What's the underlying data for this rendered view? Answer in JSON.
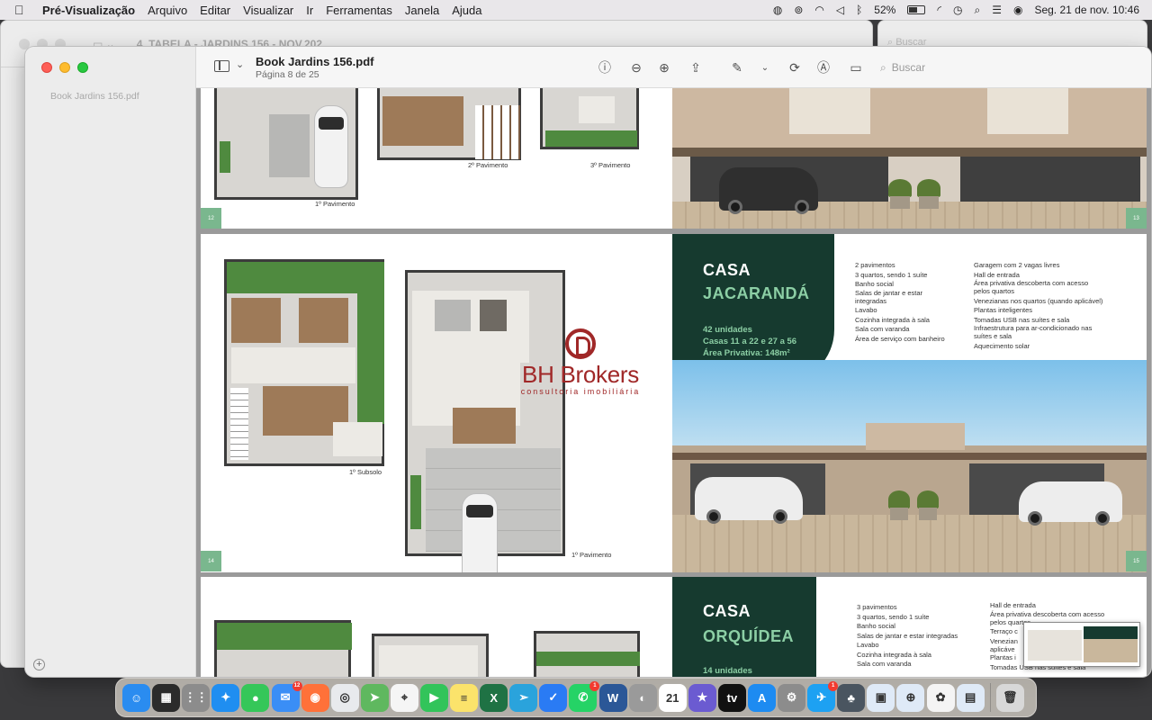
{
  "menubar": {
    "app_name": "Pré-Visualização",
    "menus": [
      "Arquivo",
      "Editar",
      "Visualizar",
      "Ir",
      "Ferramentas",
      "Janela",
      "Ajuda"
    ],
    "battery": "52%",
    "datetime": "Seg. 21 de nov.  10:46"
  },
  "back_window": {
    "title": "4. TABELA - JARDINS 156 - NOV.202...",
    "search_placeholder": "Buscar"
  },
  "window": {
    "sidebar_file": "Book Jardins 156.pdf",
    "doc_title": "Book Jardins 156.pdf",
    "doc_page": "Página 8 de 25",
    "search_placeholder": "Buscar"
  },
  "pages": {
    "top": {
      "labels": [
        "1º Pavimento",
        "2º Pavimento",
        "3º Pavimento"
      ],
      "num_left": "12",
      "num_right": "13"
    },
    "middle": {
      "labels": [
        "1º Subsolo",
        "1º Pavimento"
      ],
      "num_left": "14",
      "num_right": "15",
      "title1": "CASA",
      "title2": "JACARANDÁ",
      "info": [
        "42 unidades",
        "Casas 11 a 22 e 27 a 56",
        "Área Privativa: 148m²"
      ],
      "features_left": [
        "2 pavimentos",
        "3 quartos, sendo 1 suíte",
        "Banho social",
        "Salas de jantar e estar",
        "integradas",
        "Lavabo",
        "Cozinha integrada à sala",
        "Sala com varanda",
        "Área de serviço com banheiro"
      ],
      "features_right": [
        "Garagem com 2 vagas livres",
        "Hall de entrada",
        "Área privativa descoberta com acesso",
        "pelos quartos",
        "Venezianas nos quartos (quando aplicável)",
        "Plantas inteligentes",
        "Tomadas USB nas suítes e sala",
        "Infraestrutura para ar-condicionado nas",
        "suítes e sala",
        "Aquecimento solar"
      ]
    },
    "bottom": {
      "title1": "CASA",
      "title2": "ORQUÍDEA",
      "info": [
        "14 unidades"
      ],
      "features_left": [
        "3 pavimentos",
        "3 quartos, sendo 1 suíte",
        "Banho social",
        "Salas de jantar e estar integradas",
        "Lavabo",
        "Cozinha integrada à sala",
        "Sala com varanda"
      ],
      "features_right": [
        "Hall de entrada",
        "Área privativa descoberta com acesso",
        "pelos quartos",
        "Terraço c",
        "Venezian",
        "aplicáve",
        "Plantas i",
        "Tomadas USB nas suítes e sala"
      ]
    }
  },
  "watermark": {
    "name": "BH Brokers",
    "subtitle": "consultoria imobiliária"
  },
  "dock": {
    "items": [
      {
        "name": "finder",
        "color": "#2a8cf0",
        "glyph": "☺"
      },
      {
        "name": "mission-control",
        "color": "#2b2b2b",
        "glyph": "▦"
      },
      {
        "name": "launchpad",
        "color": "#8c8c8c",
        "glyph": "⋮⋮"
      },
      {
        "name": "safari",
        "color": "#1f8ef1",
        "glyph": "✦"
      },
      {
        "name": "messages",
        "color": "#35c759",
        "glyph": "●"
      },
      {
        "name": "mail",
        "color": "#3a8ef6",
        "glyph": "✉",
        "badge": "12"
      },
      {
        "name": "firefox",
        "color": "#ff7139",
        "glyph": "◉"
      },
      {
        "name": "chrome",
        "color": "#e8eaed",
        "glyph": "◎"
      },
      {
        "name": "maps",
        "color": "#5fb85f",
        "glyph": "➤"
      },
      {
        "name": "google-maps",
        "color": "#f5f5f5",
        "glyph": "⌖"
      },
      {
        "name": "facetime",
        "color": "#32c45a",
        "glyph": "▶"
      },
      {
        "name": "notes",
        "color": "#fbe36b",
        "glyph": "≡"
      },
      {
        "name": "excel",
        "color": "#1f7244",
        "glyph": "X"
      },
      {
        "name": "telegram",
        "color": "#2aa3dc",
        "glyph": "➢"
      },
      {
        "name": "things",
        "color": "#2a7bf4",
        "glyph": "✓"
      },
      {
        "name": "whatsapp",
        "color": "#25d366",
        "glyph": "✆",
        "badge": "1"
      },
      {
        "name": "word",
        "color": "#2b5797",
        "glyph": "W"
      },
      {
        "name": "disk-utility",
        "color": "#9a9a9a",
        "glyph": "◐"
      },
      {
        "name": "calendar",
        "color": "#ffffff",
        "glyph": "21"
      },
      {
        "name": "imovie",
        "color": "#6b5bd1",
        "glyph": "★"
      },
      {
        "name": "apple-tv",
        "color": "#111111",
        "glyph": "tv"
      },
      {
        "name": "app-store",
        "color": "#1d8bf1",
        "glyph": "A"
      },
      {
        "name": "system-preferences",
        "color": "#8c8c8c",
        "glyph": "⚙"
      },
      {
        "name": "twitter",
        "color": "#1da1f2",
        "glyph": "✈",
        "badge": "1"
      },
      {
        "name": "vista",
        "color": "#4a5560",
        "glyph": "♣"
      },
      {
        "name": "preview",
        "color": "#dfeaf7",
        "glyph": "▣"
      },
      {
        "name": "contacts-add",
        "color": "#dfeaf7",
        "glyph": "⊕"
      },
      {
        "name": "photos",
        "color": "#f4f4f4",
        "glyph": "✿"
      },
      {
        "name": "preview-doc",
        "color": "#dfeaf7",
        "glyph": "▤"
      },
      {
        "name": "trash",
        "color": "#d8d8d8",
        "glyph": "🗑"
      }
    ]
  },
  "colors": {
    "panel_green": "#163a2f",
    "accent_green": "#8ccfa5",
    "watermark_red": "#a02828"
  }
}
